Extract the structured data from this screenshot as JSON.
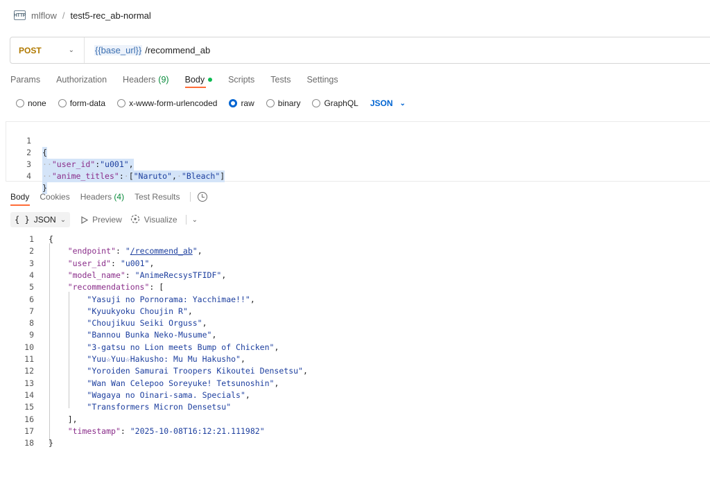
{
  "breadcrumb": {
    "icon_text": "HTTP",
    "parent": "mlflow",
    "separator": "/",
    "current": "test5-rec_ab-normal"
  },
  "request": {
    "method": "POST",
    "url_variable": "{{base_url}}",
    "url_path": "/recommend_ab"
  },
  "request_tabs": [
    {
      "label": "Params"
    },
    {
      "label": "Authorization"
    },
    {
      "label": "Headers",
      "count": "(9)"
    },
    {
      "label": "Body",
      "active": true
    },
    {
      "label": "Scripts"
    },
    {
      "label": "Tests"
    },
    {
      "label": "Settings"
    }
  ],
  "body_types": [
    {
      "label": "none",
      "checked": false
    },
    {
      "label": "form-data",
      "checked": false
    },
    {
      "label": "x-www-form-urlencoded",
      "checked": false
    },
    {
      "label": "raw",
      "checked": true
    },
    {
      "label": "binary",
      "checked": false
    },
    {
      "label": "GraphQL",
      "checked": false
    }
  ],
  "body_format": "JSON",
  "request_body_lines": [
    {
      "n": "1",
      "text": "{"
    },
    {
      "n": "2",
      "key": "\"user_id\"",
      "value": "\"u001\"",
      "tail": ","
    },
    {
      "n": "3",
      "key": "\"anime_titles\"",
      "value_array": [
        "\"Naruto\"",
        "\"Bleach\""
      ]
    },
    {
      "n": "4",
      "text": "}"
    }
  ],
  "response_tabs": [
    {
      "label": "Body",
      "active": true
    },
    {
      "label": "Cookies"
    },
    {
      "label": "Headers",
      "count": "(4)"
    },
    {
      "label": "Test Results"
    }
  ],
  "response_view": {
    "format": "JSON",
    "preview": "Preview",
    "visualize": "Visualize"
  },
  "response_body": {
    "endpoint": "/recommend_ab",
    "user_id": "u001",
    "model_name": "AnimeRecsysTFIDF",
    "recommendations": [
      "Yasuji no Pornorama: Yacchimae!!",
      "Kyuukyoku Choujin R",
      "Choujikuu Seiki Orguss",
      "Bannou Bunka Neko-Musume",
      "3-gatsu no Lion meets Bump of Chicken",
      "Yuu☆Yuu☆Hakusho: Mu Mu Hakusho",
      "Yoroiden Samurai Troopers Kikoutei Densetsu",
      "Wan Wan Celepoo Soreyuke! Tetsunoshin",
      "Wagaya no Oinari-sama. Specials",
      "Transformers Micron Densetsu"
    ],
    "timestamp": "2025-10-08T16:12:21.111982"
  },
  "response_line_numbers": [
    "1",
    "2",
    "3",
    "4",
    "5",
    "6",
    "7",
    "8",
    "9",
    "10",
    "11",
    "12",
    "13",
    "14",
    "15",
    "16",
    "17",
    "18"
  ],
  "colors": {
    "accent_tab": "#ff6c37",
    "method": "#b07900",
    "selected_radio": "#0265d2",
    "json_key": "#8a2d8a",
    "json_string": "#1c3e9e",
    "count_green": "#078a3a"
  }
}
